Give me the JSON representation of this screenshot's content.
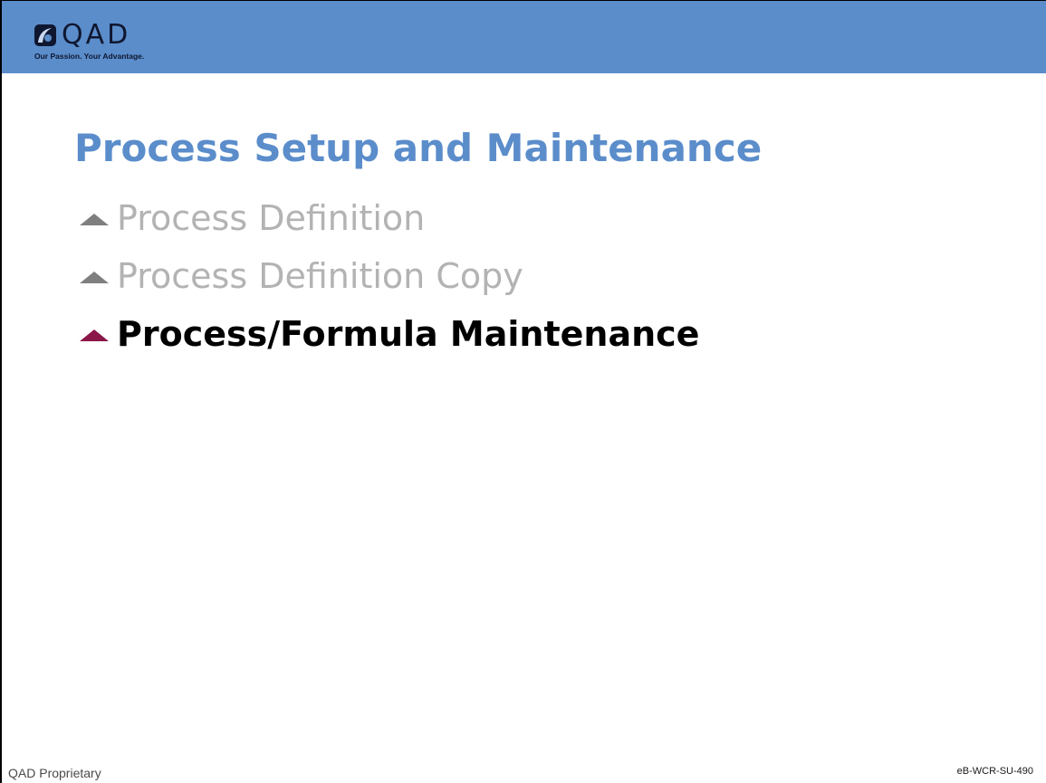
{
  "header": {
    "background_color": "#5b8dcb",
    "logo": {
      "wordmark": "QAD",
      "tagline": "Our Passion. Your Advantage.",
      "icon": "qad-globe-icon"
    }
  },
  "slide": {
    "title": "Process Setup and Maintenance",
    "title_color": "#5b8dcb",
    "bullets": [
      {
        "label": "Process Definition",
        "state": "inactive",
        "icon": "triangle-bullet-icon"
      },
      {
        "label": "Process Definition Copy",
        "state": "inactive",
        "icon": "triangle-bullet-icon"
      },
      {
        "label": "Process/Formula Maintenance",
        "state": "active",
        "icon": "triangle-bullet-icon"
      }
    ],
    "inactive_color": "#b3b3b3",
    "active_color": "#000000",
    "active_bullet_color": "#8a1748"
  },
  "footer": {
    "left": "QAD Proprietary",
    "right": "eB-WCR-SU-490"
  }
}
